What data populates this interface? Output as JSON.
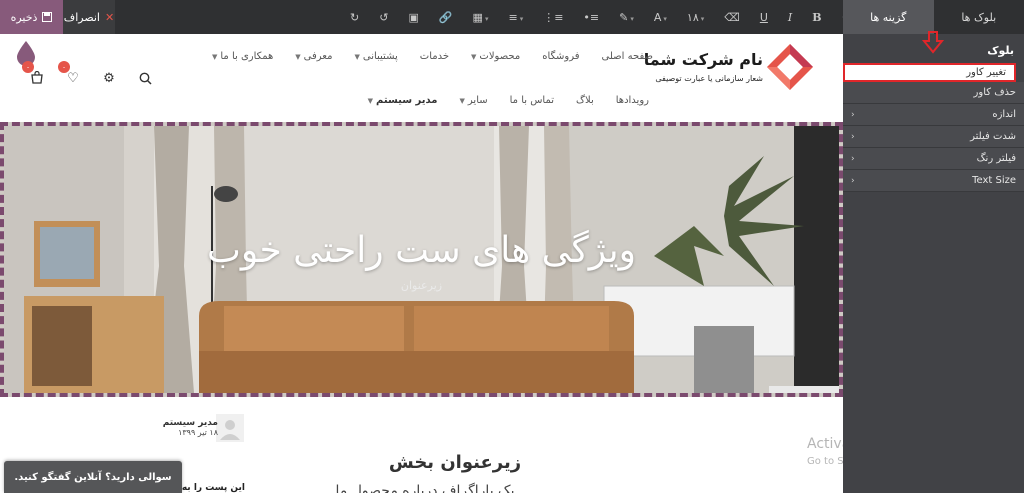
{
  "toolbar": {
    "save_label": "ذخیره",
    "discard_label": "انصراف",
    "font_size": "۱۸",
    "icons": [
      "undo-icon",
      "redo-icon",
      "link-icon",
      "image-icon",
      "table-icon",
      "paragraph-icon",
      "ordered-list-icon",
      "unordered-list-icon",
      "brush-icon",
      "font-color-icon",
      "font-size-icon",
      "eraser-icon",
      "underline-icon",
      "italic-icon",
      "bold-icon",
      "magic-icon"
    ]
  },
  "panel": {
    "tabs": [
      {
        "label": "بلوک ها",
        "active": false
      },
      {
        "label": "گزینه ها",
        "active": true
      }
    ],
    "section_title": "بلوک",
    "options": [
      {
        "label": "تغییر کاور",
        "highlighted": true,
        "has_sub": false
      },
      {
        "label": "حذف کاور",
        "highlighted": false,
        "has_sub": false
      },
      {
        "label": "اندازه",
        "highlighted": false,
        "has_sub": true
      },
      {
        "label": "شدت فیلتر",
        "highlighted": false,
        "has_sub": true
      },
      {
        "label": "فیلتر رنگ",
        "highlighted": false,
        "has_sub": true
      },
      {
        "label": "Text Size",
        "highlighted": false,
        "has_sub": true
      }
    ],
    "accent_color": "#e0262a"
  },
  "site": {
    "logo_name": "نام شرکت شما",
    "logo_tagline": "شعار سازمانی یا عبارت توصیفی",
    "brand_color": "#e5554a",
    "menu_row1": [
      {
        "label": "صفحه اصلی",
        "dropdown": false
      },
      {
        "label": "فروشگاه",
        "dropdown": false
      },
      {
        "label": "محصولات",
        "dropdown": true
      },
      {
        "label": "خدمات",
        "dropdown": false
      },
      {
        "label": "پشتیبانی",
        "dropdown": true
      },
      {
        "label": "معرفی",
        "dropdown": true
      },
      {
        "label": "همکاری با ما",
        "dropdown": true
      }
    ],
    "menu_row2": [
      {
        "label": "رویدادها",
        "dropdown": false,
        "bold": false
      },
      {
        "label": "بلاگ",
        "dropdown": false,
        "bold": false
      },
      {
        "label": "تماس با ما",
        "dropdown": false,
        "bold": false
      },
      {
        "label": "سایر",
        "dropdown": true,
        "bold": false
      },
      {
        "label": "مدیر سیستم",
        "dropdown": true,
        "bold": true
      }
    ],
    "cart_count": "۰",
    "wishlist_count": "۰"
  },
  "hero": {
    "title": "ویژگی های ست راحتی خوب",
    "subtitle": "زیرعنوان",
    "border_color": "#7b4a6e"
  },
  "content": {
    "author_name": "مدیر سیستم",
    "author_date": "۱۸ تیر ۱۳۹۹",
    "section_title": "زیرعنوان بخش",
    "section_text_cut": "یک پاراگراف درباره محصول ما",
    "post_snippet": "این پست را به اشتراک بگذارید",
    "chat_label": "سوالی دارید؟ آنلاین گفتگو کنید."
  },
  "watermark": {
    "line1": "Activate Windows",
    "line2": "Go to Settings to activate Windows."
  }
}
